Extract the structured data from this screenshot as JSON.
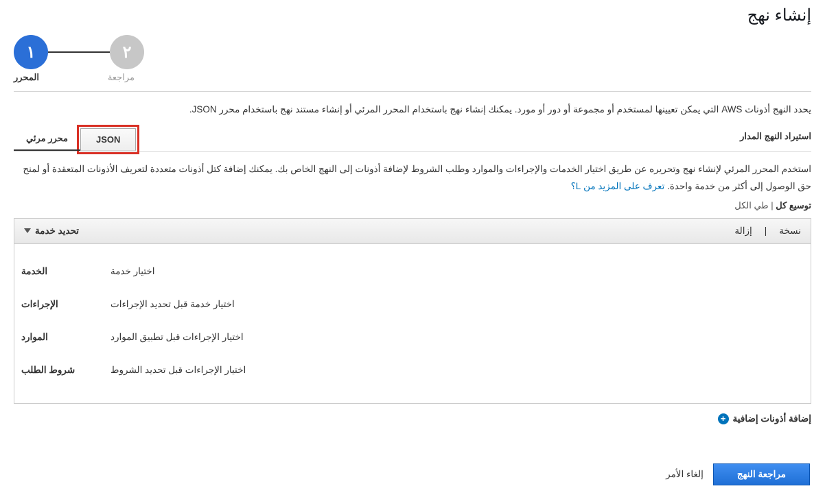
{
  "page_title": "إنشاء نهج",
  "wizard": {
    "step1_num": "١",
    "step2_num": "٢",
    "step1_label": "المحرر",
    "step2_label": "مراجعة"
  },
  "description": "يحدد النهج أذونات AWS التي يمكن تعيينها لمستخدم أو مجموعة أو دور أو مورد. يمكنك إنشاء نهج باستخدام المحرر المرئي أو إنشاء مستند نهج باستخدام محرر JSON.",
  "tabs": {
    "visual": "محرر مرئي",
    "json": "JSON",
    "import": "استيراد النهج المدار"
  },
  "subdesc": "استخدم المحرر المرئي لإنشاء نهج وتحريره عن طريق اختيار الخدمات والإجراءات والموارد وطلب الشروط لإضافة أذونات إلى النهج الخاص بك. يمكنك إضافة كتل أذونات متعددة لتعريف الأذونات المتعقدة أو لمنح حق الوصول إلى أكثر من خدمة واحدة.",
  "learn_more": "تعرف على المزيد من L؟",
  "expand": {
    "label": "توسيع كل",
    "pipe": "|",
    "collapse": "طي الكل"
  },
  "svc_header": {
    "title": "تحديد خدمة",
    "copy": "نسخة",
    "remove": "إزالة"
  },
  "fields": {
    "service_label": "الخدمة",
    "service_value": "اختيار خدمة",
    "actions_label": "الإجراءات",
    "actions_value": "اختيار خدمة قبل تحديد الإجراءات",
    "resources_label": "الموارد",
    "resources_value": "اختيار الإجراءات قبل تطبيق الموارد",
    "conditions_label": "شروط الطلب",
    "conditions_value": "اختيار الإجراءات قبل تحديد الشروط"
  },
  "add_perms": "إضافة أذونات إضافية",
  "footer": {
    "review": "مراجعة النهج",
    "cancel": "إلغاء الأمر"
  }
}
